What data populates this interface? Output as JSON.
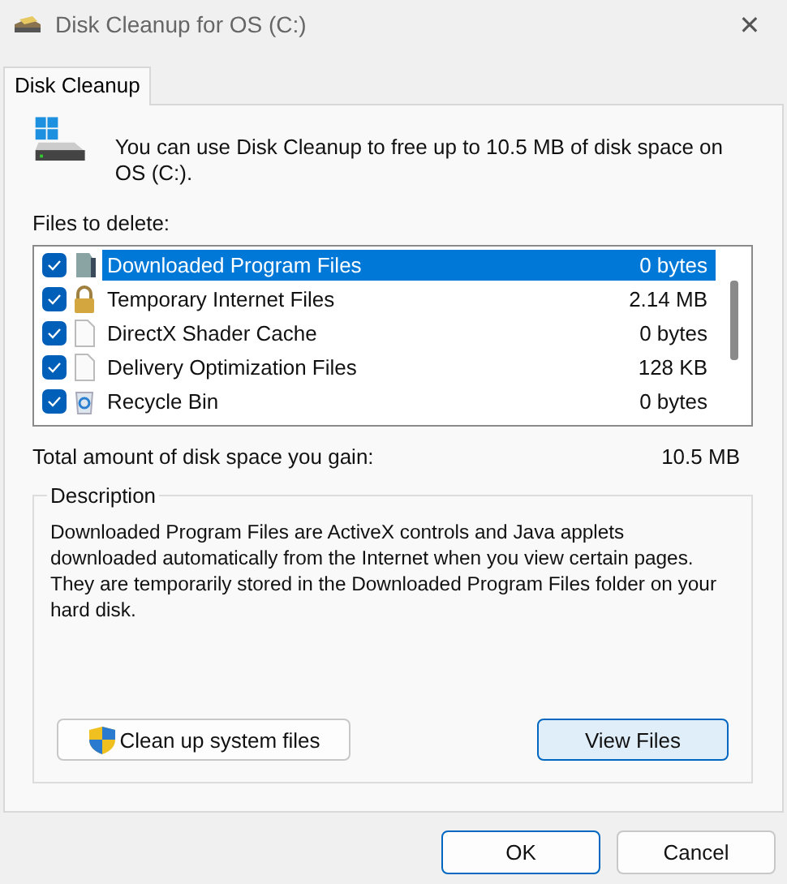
{
  "window": {
    "title": "Disk Cleanup for OS (C:)",
    "close": "✕"
  },
  "tabs": [
    {
      "label": "Disk Cleanup",
      "selected": true
    }
  ],
  "intro": "You can use Disk Cleanup to free up to 10.5 MB of disk space on OS (C:).",
  "files_label": "Files to delete:",
  "files": [
    {
      "kind": "folder",
      "label": "Downloaded Program Files",
      "size": "0 bytes",
      "checked": true,
      "selected": true
    },
    {
      "kind": "lock",
      "label": "Temporary Internet Files",
      "size": "2.14 MB",
      "checked": true,
      "selected": false
    },
    {
      "kind": "document",
      "label": "DirectX Shader Cache",
      "size": "0 bytes",
      "checked": true,
      "selected": false
    },
    {
      "kind": "document",
      "label": "Delivery Optimization Files",
      "size": "128 KB",
      "checked": true,
      "selected": false
    },
    {
      "kind": "recycle",
      "label": "Recycle Bin",
      "size": "0 bytes",
      "checked": true,
      "selected": false
    }
  ],
  "total": {
    "label": "Total amount of disk space you gain:",
    "value": "10.5 MB"
  },
  "description": {
    "title": "Description",
    "text": "Downloaded Program Files are ActiveX controls and Java applets downloaded automatically from the Internet when you view certain pages. They are temporarily stored in the Downloaded Program Files folder on your hard disk."
  },
  "actions": {
    "cleanup": "Clean up system files",
    "view": "View Files"
  },
  "buttons": [
    "OK",
    "Cancel"
  ]
}
